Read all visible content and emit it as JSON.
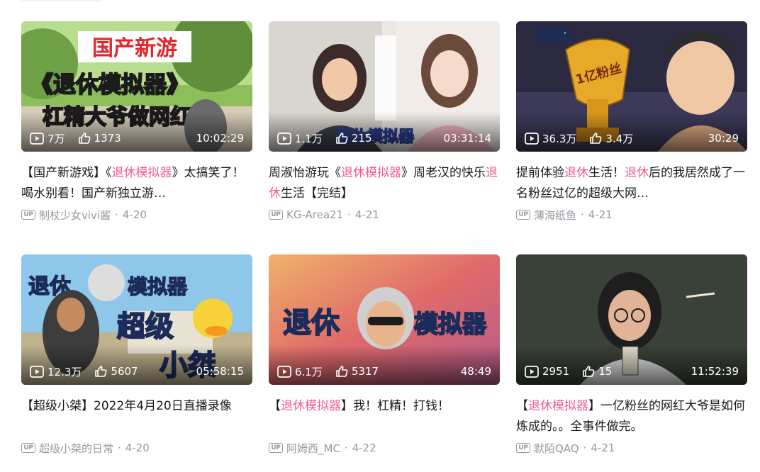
{
  "videos": [
    {
      "views": "7万",
      "likes": "1373",
      "duration": "10:02:29",
      "title_parts": [
        {
          "t": "【国产新游戏】《",
          "hl": false
        },
        {
          "t": "退休模拟器",
          "hl": true
        },
        {
          "t": "》太搞笑了！喝水别看！国产新独立游…",
          "hl": false
        }
      ],
      "author": "制杖少女vivi酱",
      "date": "4-20",
      "thumb_text": [
        "国产新游",
        "《退休模拟器》",
        "杠精大爷做网红！"
      ],
      "colors": {
        "bg": "#7fb04e",
        "sky": "#a9d37a"
      }
    },
    {
      "views": "1.1万",
      "likes": "215",
      "duration": "03:31:14",
      "title_parts": [
        {
          "t": "周淑怡游玩《",
          "hl": false
        },
        {
          "t": "退休模拟器",
          "hl": true
        },
        {
          "t": "》周老汉的快乐",
          "hl": false
        },
        {
          "t": "退休",
          "hl": true
        },
        {
          "t": "生活【完结】",
          "hl": false
        }
      ],
      "author": "KG-Area21",
      "date": "4-21",
      "thumb_text": [
        "退休模拟器"
      ],
      "colors": {
        "bg": "#e9e6e3",
        "sky": "#f5d6dc"
      }
    },
    {
      "views": "36.3万",
      "likes": "3.4万",
      "duration": "30:29",
      "title_parts": [
        {
          "t": "提前体验",
          "hl": false
        },
        {
          "t": "退休",
          "hl": true
        },
        {
          "t": "生活！",
          "hl": false
        },
        {
          "t": "退休",
          "hl": true
        },
        {
          "t": "后的我居然成了一名粉丝过亿的超级大网…",
          "hl": false
        }
      ],
      "author": "薄海纸鱼",
      "date": "4-21",
      "thumb_text": [
        "退休",
        "1亿粉丝"
      ],
      "colors": {
        "bg": "#2c2a3e",
        "sky": "#d9a52b"
      }
    },
    {
      "views": "12.3万",
      "likes": "5607",
      "duration": "05:58:15",
      "title_parts": [
        {
          "t": "【超级小桀】2022年4月20日直播录像",
          "hl": false
        }
      ],
      "author": "超级小桀的日常",
      "date": "4-20",
      "thumb_text": [
        "退休",
        "模拟器",
        "超级",
        "小桀"
      ],
      "colors": {
        "bg": "#5aa3d6",
        "sky": "#9ed0f0"
      }
    },
    {
      "views": "6.1万",
      "likes": "5317",
      "duration": "48:49",
      "title_parts": [
        {
          "t": "【",
          "hl": false
        },
        {
          "t": "退休模拟器",
          "hl": true
        },
        {
          "t": "】我！杠精！打钱！",
          "hl": false
        }
      ],
      "author": "阿姆西_MC",
      "date": "4-22",
      "thumb_text": [
        "退休",
        "模拟器"
      ],
      "colors": {
        "bg": "#e08a5a",
        "sky": "#d6658a"
      }
    },
    {
      "views": "2951",
      "likes": "15",
      "duration": "11:52:39",
      "title_parts": [
        {
          "t": "【",
          "hl": false
        },
        {
          "t": "退休模拟器",
          "hl": true
        },
        {
          "t": "】一亿粉丝的网红大爷是如何炼成的。。全事件做完。",
          "hl": false
        }
      ],
      "author": "默陌QAQ",
      "date": "4-21",
      "thumb_text": [],
      "colors": {
        "bg": "#3a4a3d",
        "sky": "#6c6a55"
      }
    }
  ],
  "up_badge": "UP"
}
